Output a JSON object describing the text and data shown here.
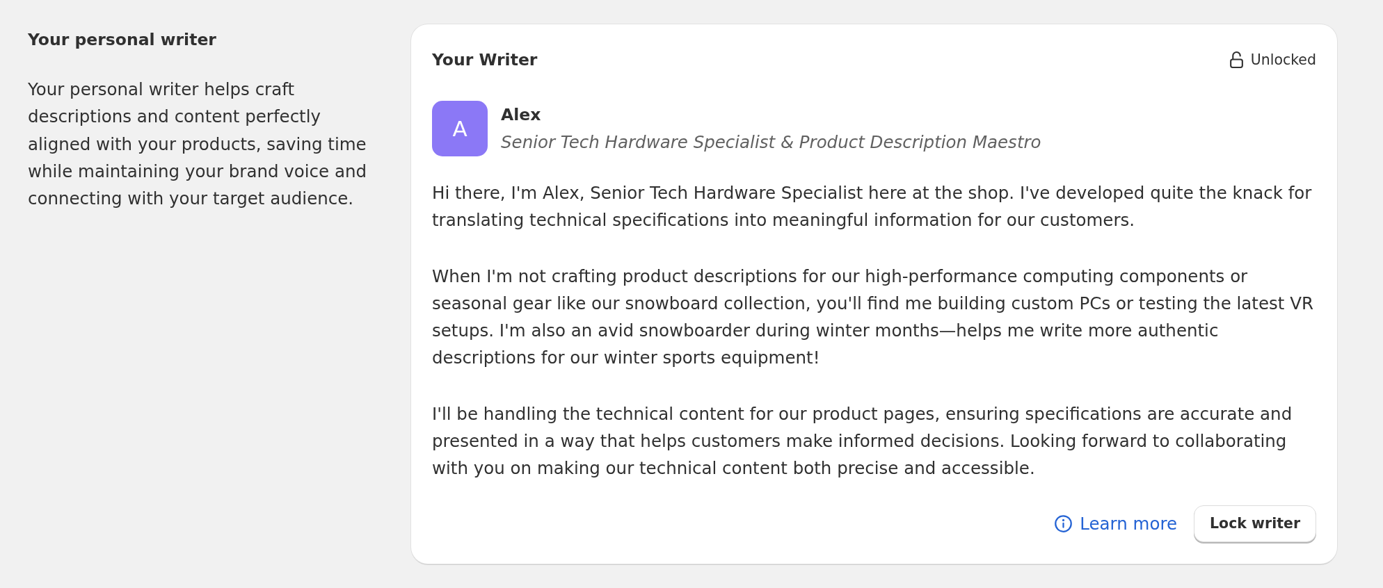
{
  "section": {
    "title": "Your personal writer",
    "description": "Your personal writer helps craft descriptions and content perfectly aligned with your products, saving time while maintaining your brand voice and connecting with your target audience."
  },
  "card": {
    "title": "Your Writer",
    "status": {
      "label": "Unlocked",
      "locked": false
    },
    "writer": {
      "initial": "A",
      "name": "Alex",
      "role": "Senior Tech Hardware Specialist & Product Description Maestro"
    },
    "paragraphs": [
      "Hi there, I'm Alex, Senior Tech Hardware Specialist here at the shop. I've developed quite the knack for translating technical specifications into meaningful information for our customers.",
      "When I'm not crafting product descriptions for our high-performance computing components or seasonal gear like our snowboard collection, you'll find me building custom PCs or testing the latest VR setups. I'm also an avid snowboarder during winter months—helps me write more authentic descriptions for our winter sports equipment!",
      "I'll be handling the technical content for our product pages, ensuring specifications are accurate and presented in a way that helps customers make informed decisions. Looking forward to collaborating with you on making our technical content both precise and accessible."
    ],
    "actions": {
      "link": "Learn more",
      "button": "Lock writer"
    }
  }
}
